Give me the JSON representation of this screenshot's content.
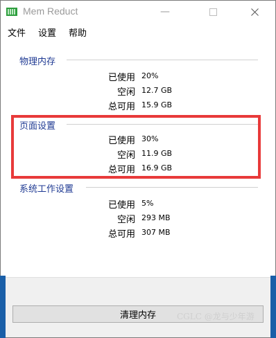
{
  "window": {
    "title": "Mem Reduct"
  },
  "menu": {
    "file": "文件",
    "settings": "设置",
    "help": "帮助"
  },
  "physical": {
    "title": "物理内存",
    "rows": [
      {
        "label": "已使用",
        "value": "20%"
      },
      {
        "label": "空闲",
        "value": "12.7 GB"
      },
      {
        "label": "总可用",
        "value": "15.9 GB"
      }
    ]
  },
  "page": {
    "title": "页面设置",
    "rows": [
      {
        "label": "已使用",
        "value": "30%"
      },
      {
        "label": "空闲",
        "value": "11.9 GB"
      },
      {
        "label": "总可用",
        "value": "16.9 GB"
      }
    ]
  },
  "system": {
    "title": "系统工作设置",
    "rows": [
      {
        "label": "已使用",
        "value": "5%"
      },
      {
        "label": "空闲",
        "value": "293 MB"
      },
      {
        "label": "总可用",
        "value": "307 MB"
      }
    ]
  },
  "actions": {
    "clean_label": "清理内存"
  },
  "watermark": {
    "text": "CGLC @龙与少年游"
  },
  "colors": {
    "highlight": "#e83a3a",
    "group_title": "#1f3a93",
    "accent_blue": "#1a5fa8"
  }
}
